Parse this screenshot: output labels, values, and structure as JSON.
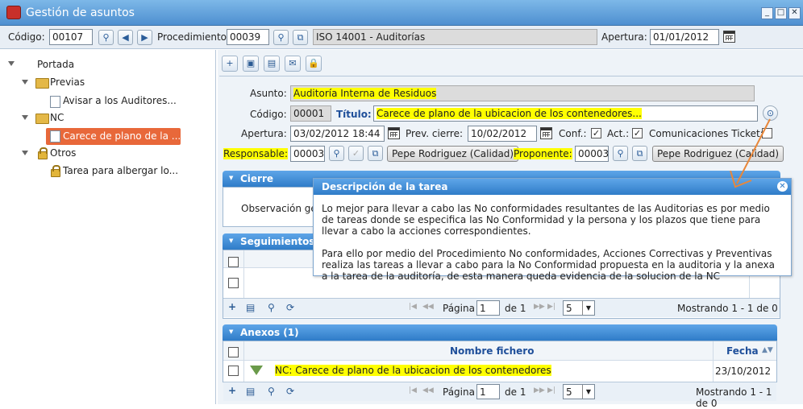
{
  "window": {
    "title": "Gestión de asuntos",
    "min": "_",
    "max": "□",
    "close": "✕"
  },
  "header": {
    "codigo_label": "Código:",
    "codigo_value": "00107",
    "procedimiento_label": "Procedimiento",
    "procedimiento_value": "00039",
    "procedimiento_name": "ISO 14001 - Auditorías",
    "apertura_label": "Apertura:",
    "apertura_value": "01/01/2012"
  },
  "tree": {
    "root": "Portada",
    "previas": "Previas",
    "previas_item": "Avisar a los Auditores...",
    "nc": "NC",
    "nc_item": "Carece de plano de la ...",
    "otros": "Otros",
    "otros_item": "Tarea para albergar lo..."
  },
  "toolbar": {
    "add": "+",
    "save": "💾",
    "delete": "🗑",
    "mail": "✉",
    "lock": "🔒"
  },
  "form": {
    "asunto_label": "Asunto:",
    "asunto_value": "Auditoría Interna de Residuos",
    "codigo_label": "Código:",
    "codigo_value": "00001",
    "titulo_label": "Título:",
    "titulo_value": "Carece de plano de la ubicacion de los contenedores...",
    "apertura_label": "Apertura:",
    "apertura_value": "03/02/2012 18:44",
    "prev_cierre_label": "Prev. cierre:",
    "prev_cierre_value": "10/02/2012",
    "conf_label": "Conf.:",
    "act_label": "Act.:",
    "com_label": "Comunicaciones Ticket:",
    "responsable_label": "Responsable:",
    "responsable_code": "00003",
    "responsable_name": "Pepe Rodriguez (Calidad)",
    "proponente_label": "Proponente:",
    "proponente_code": "00003",
    "proponente_name": "Pepe Rodriguez (Calidad)"
  },
  "cierre": {
    "title": "Cierre",
    "observacion_label": "Observación ge"
  },
  "seguimientos": {
    "title": "Seguimientos"
  },
  "pager": {
    "pagina_label": "Página",
    "page": "1",
    "of": "de 1",
    "size": "5",
    "mostrando": "Mostrando 1 - 1 de 0",
    "first": "|◀",
    "prev": "◀◀",
    "next": "▶▶",
    "last": "▶|",
    "refresh": "⟳"
  },
  "anexos": {
    "title": "Anexos (1)",
    "col_nombre": "Nombre fichero",
    "col_fecha": "Fecha",
    "rows": [
      {
        "nombre": "NC: Carece de plano de la ubicacion de los contenedores",
        "fecha": "23/10/2012"
      }
    ]
  },
  "tooltip": {
    "title": "Descripción de la tarea",
    "body": "Lo mejor para llevar a cabo las No conformidades resultantes de las Auditorias es por medio de tareas donde se especifica las No Conformidad y la persona y los plazos que tiene para llevar a cabo la acciones correspondientes.\n\nPara ello por medio del Procedimiento No conformidades, Acciones Correctivas y Preventivas realiza las tareas a llevar a cabo para la No Conformidad propuesta en la auditoria y la anexa a la tarea de la auditoría, de esta manera queda evidencia de la solucion de la NC"
  },
  "colors": {
    "highlight": "#ffff00",
    "header_blue": "#2f7cc8",
    "selected": "#e8683a",
    "arrow": "#e8873a"
  }
}
